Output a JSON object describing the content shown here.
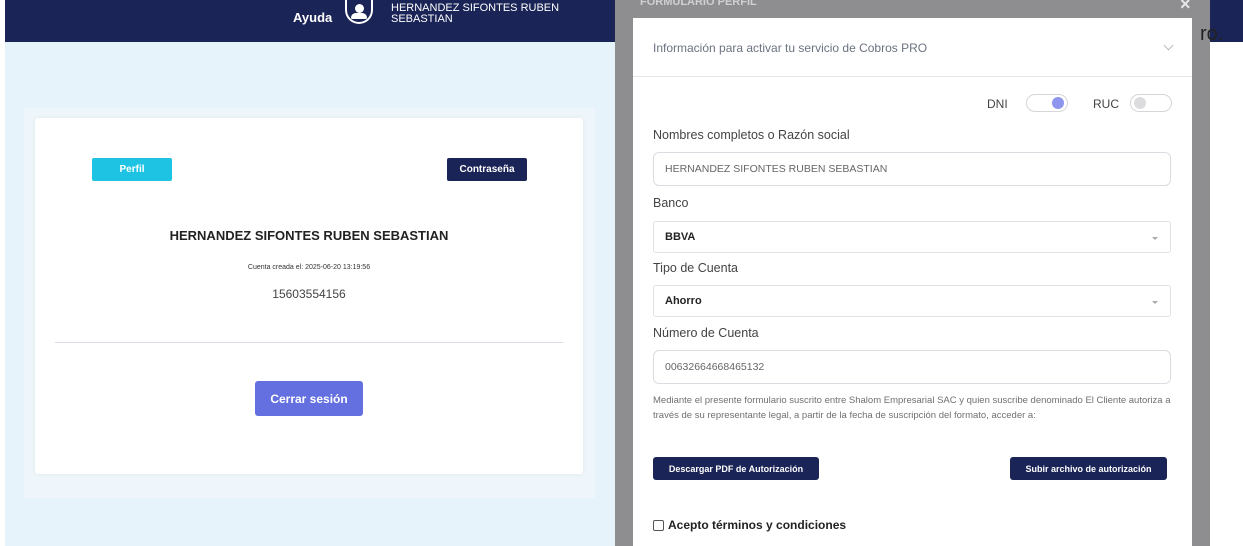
{
  "header": {
    "help_label": "Ayuda",
    "user_name": "HERNANDEZ SIFONTES RUBEN SEBASTIAN"
  },
  "profile": {
    "tabs": {
      "perfil": "Perfil",
      "password": "Contraseña"
    },
    "full_name": "HERNANDEZ SIFONTES RUBEN SEBASTIAN",
    "created_label": "Cuenta creada el: 2025-06-20 13:19:56",
    "phone": "15603554156",
    "logout_label": "Cerrar sesión"
  },
  "trailing_text": "ro.",
  "panel": {
    "accordion_title": "Información para activar tu servicio de Cobros PRO",
    "doc_type": {
      "dni_label": "DNI",
      "ruc_label": "RUC",
      "dni_on": true,
      "ruc_on": false
    },
    "name_label": "Nombres completos o Razón social",
    "name_value": "HERNANDEZ SIFONTES RUBEN SEBASTIAN",
    "bank_label": "Banco",
    "bank_value": "BBVA",
    "account_type_label": "Tipo de Cuenta",
    "account_type_value": "Ahorro",
    "account_number_label": "Número de Cuenta",
    "account_number_value": "00632664668465132",
    "legal_text": "Mediante el presente formulario suscrito entre Shalom Empresarial SAC y quien suscribe denominado El Cliente autoriza a través de su representante legal, a partir de la fecha de suscripción del formato, acceder a:",
    "download_pdf_label": "Descargar PDF de Autorización",
    "upload_label": "Subir archivo de autorización",
    "terms_label": "Acepto términos y condiciones"
  },
  "colors": {
    "navy": "#1a2456",
    "cyan": "#1ec3e4",
    "accent": "#6470e0",
    "toggle_on": "#8d95ef"
  }
}
